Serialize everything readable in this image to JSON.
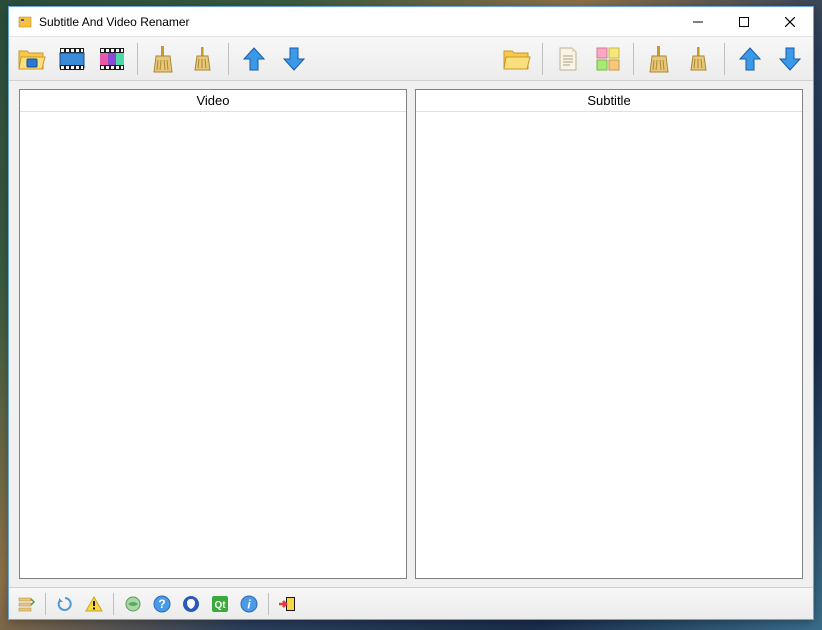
{
  "window": {
    "title": "Subtitle And Video Renamer"
  },
  "panels": {
    "video_header": "Video",
    "subtitle_header": "Subtitle"
  },
  "toolbar": {
    "left_icons": [
      "open-folder",
      "video-clapper",
      "video-clapper-color",
      "broom",
      "small-broom",
      "arrow-up",
      "arrow-down"
    ],
    "right_icons": [
      "open-folder",
      "document",
      "color-blocks",
      "broom",
      "small-broom",
      "arrow-up",
      "arrow-down"
    ]
  },
  "bottombar": {
    "icons": [
      "list",
      "refresh",
      "warning",
      "globe",
      "help",
      "badge",
      "qt",
      "info",
      "exit"
    ]
  }
}
